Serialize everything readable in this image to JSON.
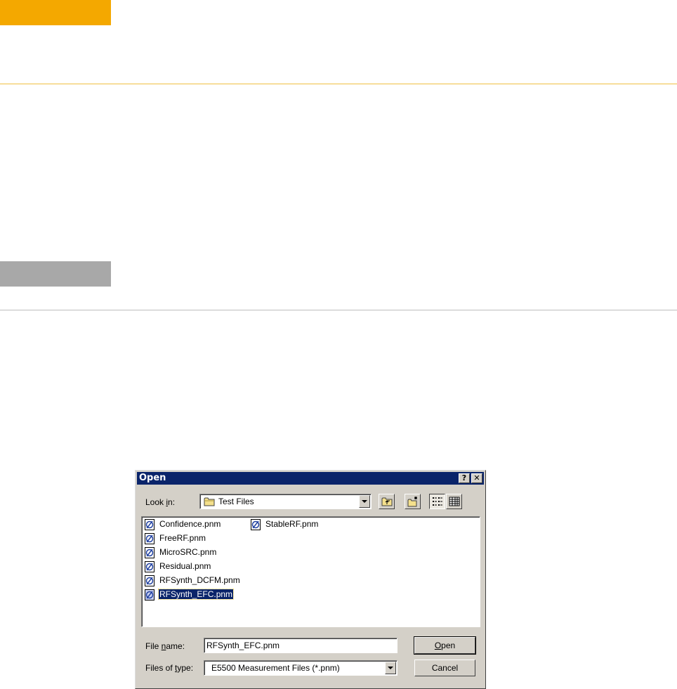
{
  "dialog": {
    "title": "Open",
    "help_label": "?",
    "close_label": "✕",
    "look_in": {
      "label_pre": "Look ",
      "label_accel": "i",
      "label_post": "n:",
      "value": "Test Files"
    },
    "files": [
      {
        "name": "Confidence.pnm",
        "selected": false
      },
      {
        "name": "FreeRF.pnm",
        "selected": false
      },
      {
        "name": "MicroSRC.pnm",
        "selected": false
      },
      {
        "name": "Residual.pnm",
        "selected": false
      },
      {
        "name": "RFSynth_DCFM.pnm",
        "selected": false
      },
      {
        "name": "RFSynth_EFC.pnm",
        "selected": true
      },
      {
        "name": "StableRF.pnm",
        "selected": false
      }
    ],
    "file_name": {
      "label_pre": "File ",
      "label_accel": "n",
      "label_post": "ame:",
      "value": "RFSynth_EFC.pnm"
    },
    "file_type": {
      "label_pre": "Files of ",
      "label_accel": "t",
      "label_post": "ype:",
      "value": "E5500 Measurement Files (*.pnm)"
    },
    "open_button": {
      "accel": "O",
      "rest": "pen"
    },
    "cancel_button": "Cancel",
    "active_view": "list"
  },
  "colors": {
    "title_bar": "#0a246a",
    "dialog_face": "#d4d0c8",
    "page_tab_orange": "#f4a800",
    "page_tab_gray": "#a8a8a8"
  }
}
